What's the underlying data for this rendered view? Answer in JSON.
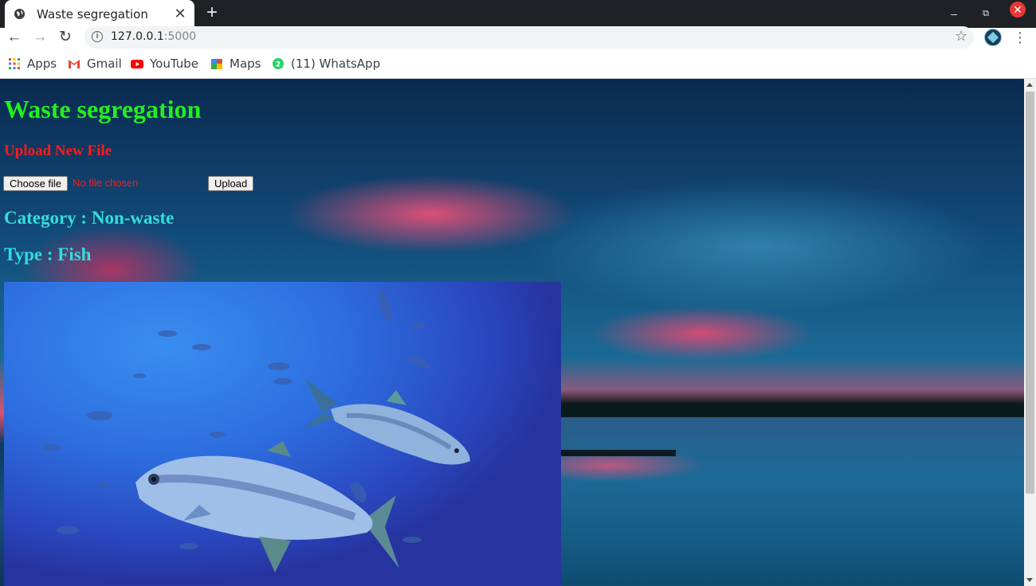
{
  "browser": {
    "tab_title": "Waste segregation",
    "url_host": "127.0.0.1",
    "url_port": ":5000",
    "bookmarks": [
      "Apps",
      "Gmail",
      "YouTube",
      "Maps",
      "(11) WhatsApp"
    ],
    "whatsapp_badge": "2"
  },
  "page": {
    "title": "Waste segregation",
    "upload_heading": "Upload New File",
    "choose_file_label": "Choose file",
    "no_file_text": "No file chosen",
    "upload_button": "Upload",
    "category_text": "Category : Non-waste",
    "type_text": "Type : Fish"
  },
  "colors": {
    "title": "#22ee22",
    "upload_heading": "#ff1a1a",
    "result_text": "#33dddd"
  }
}
